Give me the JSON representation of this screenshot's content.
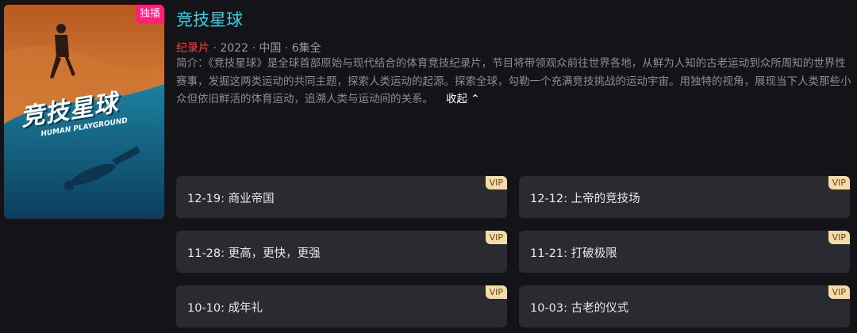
{
  "show": {
    "poster": {
      "badge": "独播",
      "title_art": "竞技星球",
      "subtitle_art": "HUMAN PLAYGROUND"
    },
    "title": "竞技星球",
    "meta": {
      "genre": "纪录片",
      "year": "2022",
      "region": "中国",
      "episodes": "6集全",
      "separator": " · "
    },
    "synopsis": "简介：《竞技星球》是全球首部原始与现代结合的体育竞技纪录片，节目将带领观众前往世界各地，从鲜为人知的古老运动到众所周知的世界性赛事，发掘这两类运动的共同主题，探索人类运动的起源。探索全球，勾勒一个充满竞技挑战的运动宇宙。用独特的视角，展现当下人类那些小众但依旧鲜活的体育运动，追溯人类与运动间的关系。",
    "collapse_label": "收起 ⌃"
  },
  "episodes": [
    {
      "label": "12-19: 商业帝国",
      "badge": "VIP"
    },
    {
      "label": "12-12: 上帝的竞技场",
      "badge": "VIP"
    },
    {
      "label": "11-28: 更高，更快，更强",
      "badge": "VIP"
    },
    {
      "label": "11-21: 打破极限",
      "badge": "VIP"
    },
    {
      "label": "10-10: 成年礼",
      "badge": "VIP"
    },
    {
      "label": "10-03: 古老的仪式",
      "badge": "VIP"
    }
  ],
  "colors": {
    "title": "#36d0e0",
    "genre": "#ff3c3c",
    "exclusive_badge": "#ff1f7a",
    "vip_badge": "#f3dca8",
    "episode_card": "#2a2a31",
    "background": "#141318"
  }
}
